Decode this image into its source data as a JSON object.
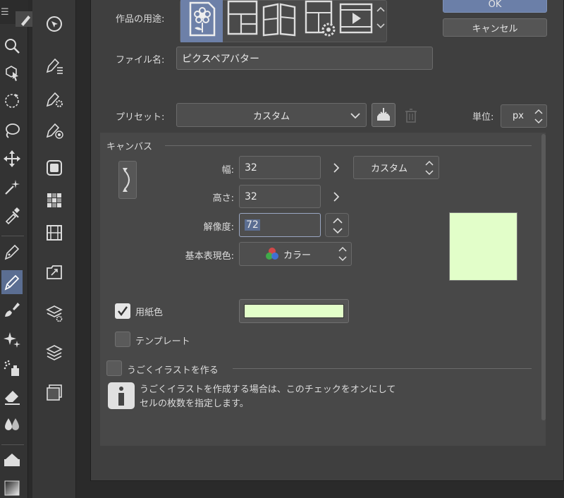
{
  "toolbar": {
    "menu_glyph": "☰",
    "tools": [
      "magnifier-icon",
      "object-select-icon",
      "rotate-icon",
      "lasso-icon",
      "move-icon",
      "magic-wand-icon",
      "eyedropper-icon",
      "pen-icon",
      "pencil-icon",
      "brush-icon",
      "decoration-icon",
      "airbrush-icon",
      "eraser-icon",
      "blend-icon",
      "fill-icon",
      "gradient-icon"
    ],
    "active_tool": "pencil-icon"
  },
  "subbar": {
    "items": [
      "navigator-icon",
      "sub-tool-icon",
      "tool-property-icon",
      "brush-size-icon",
      "color-wheel-icon",
      "color-set-icon",
      "animation-timeline-icon",
      "material-icon",
      "layer-property-icon",
      "layer-icon",
      "canvas-icon"
    ]
  },
  "dialog": {
    "usage_label": "作品の用途:",
    "usage_icons": [
      "illustration-icon",
      "comic-icon",
      "comic-book-icon",
      "settings-print-icon",
      "animation-icon"
    ],
    "ok_label": "OK",
    "cancel_label": "キャンセル",
    "filename_label": "ファイル名:",
    "filename_value": "ピクスペアバター",
    "preset_label": "プリセット:",
    "preset_value": "カスタム",
    "unit_label": "単位:",
    "unit_value": "px",
    "canvas_section": "キャンバス",
    "width_label": "幅:",
    "width_value": "32",
    "height_label": "高さ:",
    "height_value": "32",
    "size_preset_value": "カスタム",
    "resolution_label": "解像度:",
    "resolution_value": "72",
    "color_mode_label": "基本表現色:",
    "color_mode_value": "カラー",
    "paper_color_label": "用紙色",
    "paper_color_checked": true,
    "paper_color": "#e2fec9",
    "template_label": "テンプレート",
    "template_checked": false,
    "animated_label": "うごくイラストを作る",
    "animated_checked": false,
    "info_line1": "うごくイラストを作成する場合は、このチェックをオンにして",
    "info_line2": "セルの枚数を指定します。"
  },
  "colors": {
    "accent": "#5b6e92",
    "ok_button": "#6b7fa8",
    "paper": "#e2fec9"
  }
}
